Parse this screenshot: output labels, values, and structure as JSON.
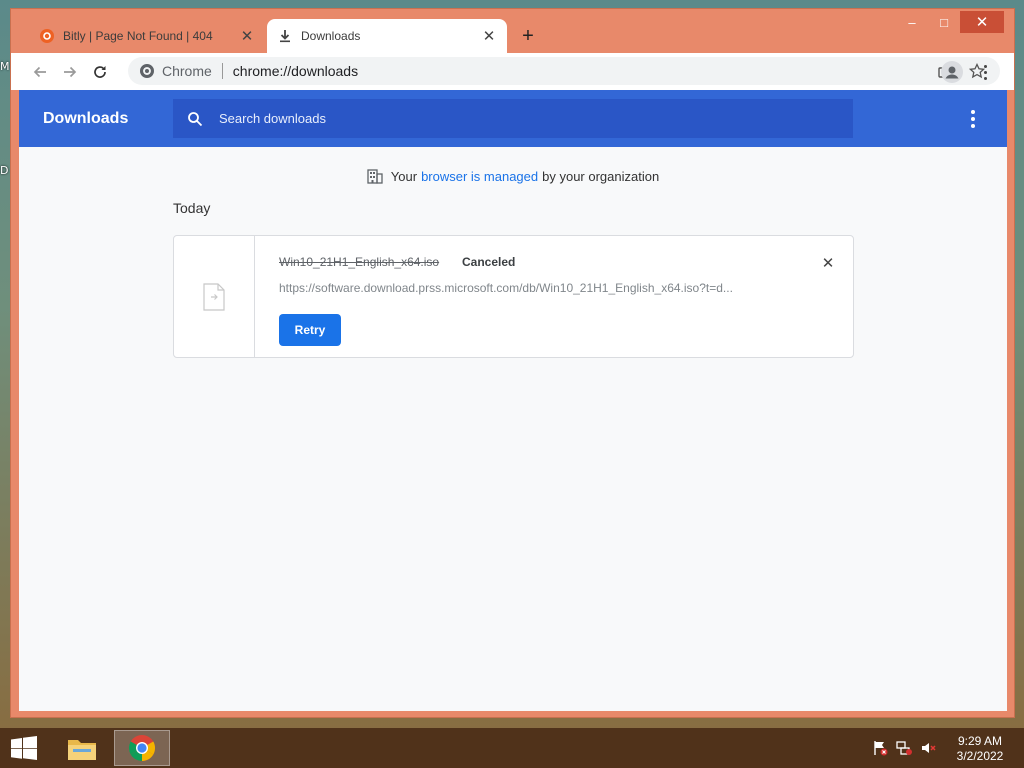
{
  "desktop": {
    "edge_labels": [
      "M",
      "D"
    ]
  },
  "tabs": [
    {
      "title": "Bitly | Page Not Found | 404",
      "icon": "bitly-icon",
      "active": false
    },
    {
      "title": "Downloads",
      "icon": "download-icon",
      "active": true
    }
  ],
  "window_controls": {
    "minimize": "–",
    "maximize": "□",
    "close": "✕"
  },
  "omnibox": {
    "scheme": "Chrome",
    "url": "chrome://downloads"
  },
  "page": {
    "header_title": "Downloads",
    "search_placeholder": "Search downloads",
    "managed_notice": {
      "prefix": "Your",
      "link": "browser is managed",
      "suffix": "by your organization"
    },
    "date_group": "Today",
    "downloads": [
      {
        "file_name": "Win10_21H1_English_x64.iso",
        "status": "Canceled",
        "url": "https://software.download.prss.microsoft.com/db/Win10_21H1_English_x64.iso?t=d...",
        "action": "Retry"
      }
    ]
  },
  "taskbar": {
    "apps": [
      "file-explorer",
      "chrome"
    ],
    "clock": {
      "time": "9:29 AM",
      "date": "3/2/2022"
    }
  },
  "colors": {
    "window_frame": "#e8896a",
    "header_blue": "#3367d6",
    "search_blue": "#2a56c6",
    "button_blue": "#1a73e8"
  }
}
